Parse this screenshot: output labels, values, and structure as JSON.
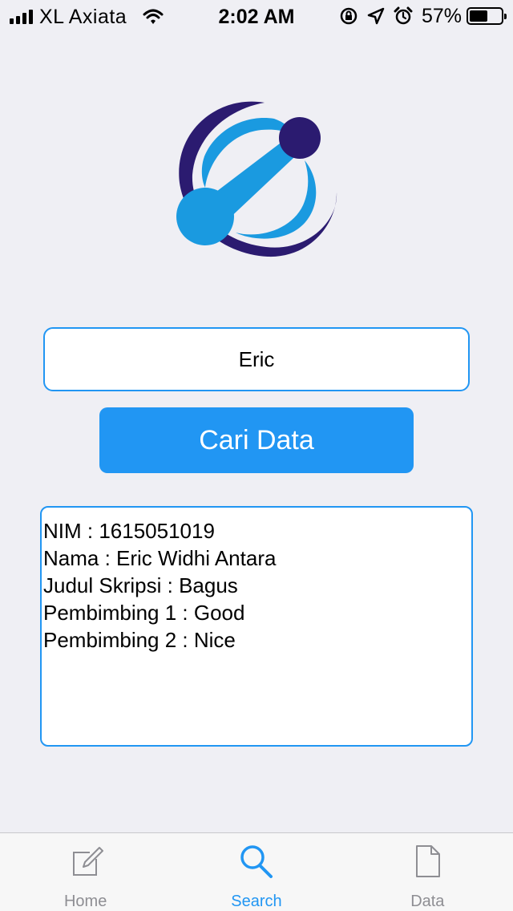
{
  "status_bar": {
    "carrier": "XL Axiata",
    "time": "2:02 AM",
    "battery_percent": "57%",
    "battery_level": 0.57
  },
  "search": {
    "value": "Eric"
  },
  "button": {
    "label": "Cari Data"
  },
  "result": {
    "lines": [
      "NIM : 1615051019",
      "Nama : Eric Widhi Antara",
      "Judul Skripsi : Bagus",
      "Pembimbing 1 : Good",
      "Pembimbing 2 : Nice"
    ]
  },
  "tab_bar": {
    "tabs": [
      {
        "label": "Home",
        "icon": "compose-icon",
        "active": false
      },
      {
        "label": "Search",
        "icon": "search-icon",
        "active": true
      },
      {
        "label": "Data",
        "icon": "document-icon",
        "active": false
      }
    ]
  },
  "colors": {
    "accent": "#2196f3",
    "logo_dark": "#2b1b70",
    "logo_light": "#1a9ae0",
    "background": "#efeff4"
  }
}
